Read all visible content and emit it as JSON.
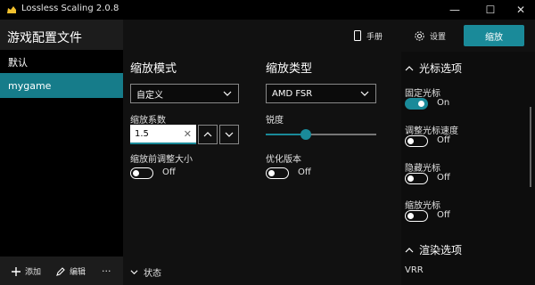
{
  "window": {
    "title": "Lossless Scaling 2.0.8",
    "minimize": "—",
    "maximize": "☐",
    "close": "✕"
  },
  "sidebar": {
    "heading": "游戏配置文件",
    "items": [
      {
        "label": "默认"
      },
      {
        "label": "mygame"
      }
    ],
    "footer": {
      "add": "添加",
      "edit": "编辑",
      "more": "···"
    }
  },
  "toolbar": {
    "manual": "手册",
    "settings": "设置",
    "scale": "缩放"
  },
  "scaling_mode": {
    "title": "缩放模式",
    "selected": "自定义",
    "factor_label": "缩放系数",
    "factor_value": "1.5",
    "resize_label": "缩放前调整大小",
    "resize_state": "Off"
  },
  "scaling_type": {
    "title": "缩放类型",
    "selected": "AMD FSR",
    "sharpness_label": "锐度",
    "sharpness_value": 0.36,
    "optimize_label": "优化版本",
    "optimize_state": "Off"
  },
  "cursor": {
    "title": "光标选项",
    "items": [
      {
        "label": "固定光标",
        "state": "On"
      },
      {
        "label": "调整光标速度",
        "state": "Off"
      },
      {
        "label": "隐藏光标",
        "state": "Off"
      },
      {
        "label": "缩放光标",
        "state": "Off"
      }
    ]
  },
  "render": {
    "title": "渲染选项",
    "vrr": "VRR"
  },
  "status": {
    "label": "状态"
  },
  "colors": {
    "accent": "#1a8a99",
    "selected_item": "#167c8a"
  }
}
